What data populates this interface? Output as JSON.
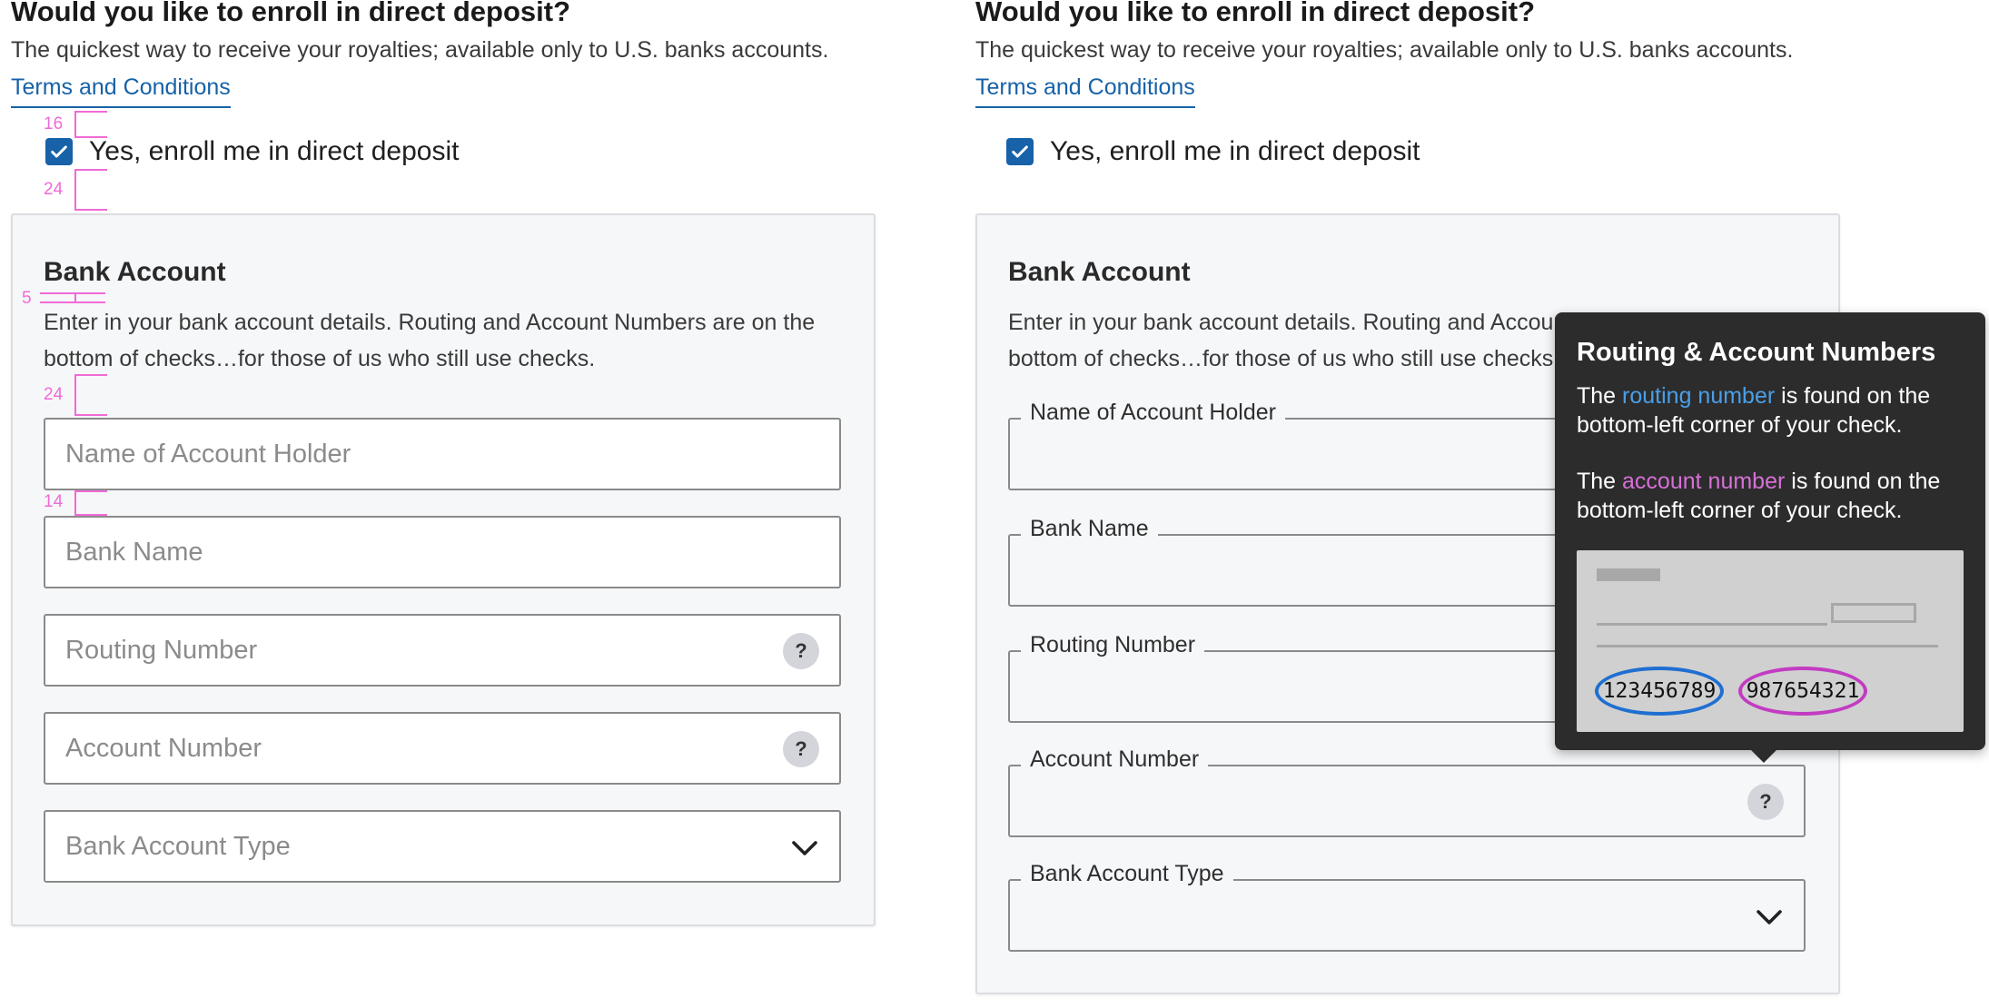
{
  "question": {
    "title": "Would you like to enroll in direct deposit?",
    "subtitle": "The quickest way to receive your royalties; available only to U.S. banks accounts.",
    "terms_link": "Terms and Conditions"
  },
  "enroll": {
    "label": "Yes, enroll me in direct deposit",
    "checked": true
  },
  "card": {
    "title": "Bank Account",
    "description": "Enter in your bank account details. Routing and Account Numbers are on the bottom of checks…for those of us who still use checks."
  },
  "fields": {
    "account_holder": "Name of Account Holder",
    "bank_name": "Bank Name",
    "routing_number": "Routing Number",
    "account_number": "Account Number",
    "account_type": "Bank Account Type",
    "help_symbol": "?"
  },
  "annotations": {
    "a16": "16",
    "a24_top": "24",
    "a5": "5",
    "a24_mid": "24",
    "a14": "14"
  },
  "tooltip": {
    "title": "Routing & Account Numbers",
    "routing_pre": "The ",
    "routing_hl": "routing number",
    "routing_post": " is found on the bottom-left corner of your check.",
    "account_pre": "The ",
    "account_hl": "account number",
    "account_post": " is found on the bottom-left corner of your check.",
    "sample_routing": "123456789",
    "sample_account": "987654321"
  },
  "colors": {
    "link_blue": "#1762a8",
    "annotation_pink": "#f06ad6",
    "routing_oval": "#1f6fd1",
    "account_oval": "#c23cc2"
  }
}
